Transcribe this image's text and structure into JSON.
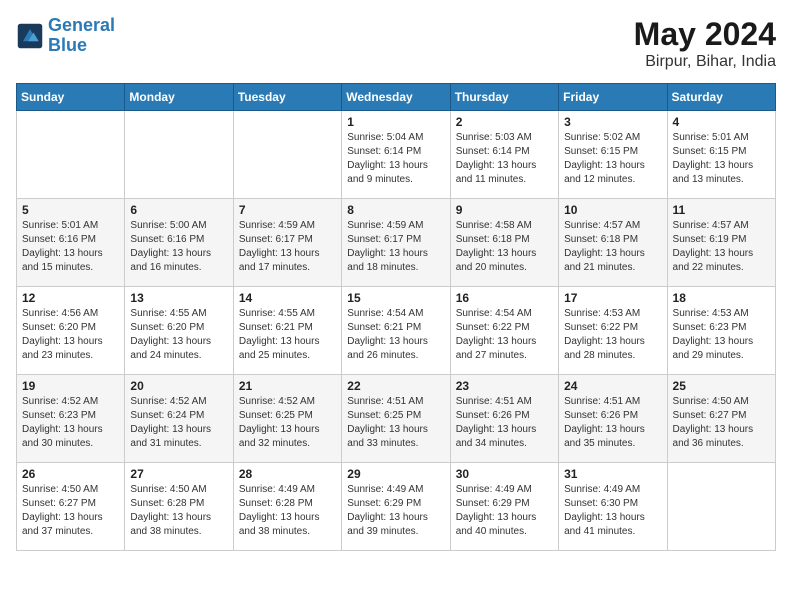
{
  "header": {
    "logo_line1": "General",
    "logo_line2": "Blue",
    "month": "May 2024",
    "location": "Birpur, Bihar, India"
  },
  "days_of_week": [
    "Sunday",
    "Monday",
    "Tuesday",
    "Wednesday",
    "Thursday",
    "Friday",
    "Saturday"
  ],
  "weeks": [
    [
      {
        "day": "",
        "info": ""
      },
      {
        "day": "",
        "info": ""
      },
      {
        "day": "",
        "info": ""
      },
      {
        "day": "1",
        "info": "Sunrise: 5:04 AM\nSunset: 6:14 PM\nDaylight: 13 hours\nand 9 minutes."
      },
      {
        "day": "2",
        "info": "Sunrise: 5:03 AM\nSunset: 6:14 PM\nDaylight: 13 hours\nand 11 minutes."
      },
      {
        "day": "3",
        "info": "Sunrise: 5:02 AM\nSunset: 6:15 PM\nDaylight: 13 hours\nand 12 minutes."
      },
      {
        "day": "4",
        "info": "Sunrise: 5:01 AM\nSunset: 6:15 PM\nDaylight: 13 hours\nand 13 minutes."
      }
    ],
    [
      {
        "day": "5",
        "info": "Sunrise: 5:01 AM\nSunset: 6:16 PM\nDaylight: 13 hours\nand 15 minutes."
      },
      {
        "day": "6",
        "info": "Sunrise: 5:00 AM\nSunset: 6:16 PM\nDaylight: 13 hours\nand 16 minutes."
      },
      {
        "day": "7",
        "info": "Sunrise: 4:59 AM\nSunset: 6:17 PM\nDaylight: 13 hours\nand 17 minutes."
      },
      {
        "day": "8",
        "info": "Sunrise: 4:59 AM\nSunset: 6:17 PM\nDaylight: 13 hours\nand 18 minutes."
      },
      {
        "day": "9",
        "info": "Sunrise: 4:58 AM\nSunset: 6:18 PM\nDaylight: 13 hours\nand 20 minutes."
      },
      {
        "day": "10",
        "info": "Sunrise: 4:57 AM\nSunset: 6:18 PM\nDaylight: 13 hours\nand 21 minutes."
      },
      {
        "day": "11",
        "info": "Sunrise: 4:57 AM\nSunset: 6:19 PM\nDaylight: 13 hours\nand 22 minutes."
      }
    ],
    [
      {
        "day": "12",
        "info": "Sunrise: 4:56 AM\nSunset: 6:20 PM\nDaylight: 13 hours\nand 23 minutes."
      },
      {
        "day": "13",
        "info": "Sunrise: 4:55 AM\nSunset: 6:20 PM\nDaylight: 13 hours\nand 24 minutes."
      },
      {
        "day": "14",
        "info": "Sunrise: 4:55 AM\nSunset: 6:21 PM\nDaylight: 13 hours\nand 25 minutes."
      },
      {
        "day": "15",
        "info": "Sunrise: 4:54 AM\nSunset: 6:21 PM\nDaylight: 13 hours\nand 26 minutes."
      },
      {
        "day": "16",
        "info": "Sunrise: 4:54 AM\nSunset: 6:22 PM\nDaylight: 13 hours\nand 27 minutes."
      },
      {
        "day": "17",
        "info": "Sunrise: 4:53 AM\nSunset: 6:22 PM\nDaylight: 13 hours\nand 28 minutes."
      },
      {
        "day": "18",
        "info": "Sunrise: 4:53 AM\nSunset: 6:23 PM\nDaylight: 13 hours\nand 29 minutes."
      }
    ],
    [
      {
        "day": "19",
        "info": "Sunrise: 4:52 AM\nSunset: 6:23 PM\nDaylight: 13 hours\nand 30 minutes."
      },
      {
        "day": "20",
        "info": "Sunrise: 4:52 AM\nSunset: 6:24 PM\nDaylight: 13 hours\nand 31 minutes."
      },
      {
        "day": "21",
        "info": "Sunrise: 4:52 AM\nSunset: 6:25 PM\nDaylight: 13 hours\nand 32 minutes."
      },
      {
        "day": "22",
        "info": "Sunrise: 4:51 AM\nSunset: 6:25 PM\nDaylight: 13 hours\nand 33 minutes."
      },
      {
        "day": "23",
        "info": "Sunrise: 4:51 AM\nSunset: 6:26 PM\nDaylight: 13 hours\nand 34 minutes."
      },
      {
        "day": "24",
        "info": "Sunrise: 4:51 AM\nSunset: 6:26 PM\nDaylight: 13 hours\nand 35 minutes."
      },
      {
        "day": "25",
        "info": "Sunrise: 4:50 AM\nSunset: 6:27 PM\nDaylight: 13 hours\nand 36 minutes."
      }
    ],
    [
      {
        "day": "26",
        "info": "Sunrise: 4:50 AM\nSunset: 6:27 PM\nDaylight: 13 hours\nand 37 minutes."
      },
      {
        "day": "27",
        "info": "Sunrise: 4:50 AM\nSunset: 6:28 PM\nDaylight: 13 hours\nand 38 minutes."
      },
      {
        "day": "28",
        "info": "Sunrise: 4:49 AM\nSunset: 6:28 PM\nDaylight: 13 hours\nand 38 minutes."
      },
      {
        "day": "29",
        "info": "Sunrise: 4:49 AM\nSunset: 6:29 PM\nDaylight: 13 hours\nand 39 minutes."
      },
      {
        "day": "30",
        "info": "Sunrise: 4:49 AM\nSunset: 6:29 PM\nDaylight: 13 hours\nand 40 minutes."
      },
      {
        "day": "31",
        "info": "Sunrise: 4:49 AM\nSunset: 6:30 PM\nDaylight: 13 hours\nand 41 minutes."
      },
      {
        "day": "",
        "info": ""
      }
    ]
  ]
}
